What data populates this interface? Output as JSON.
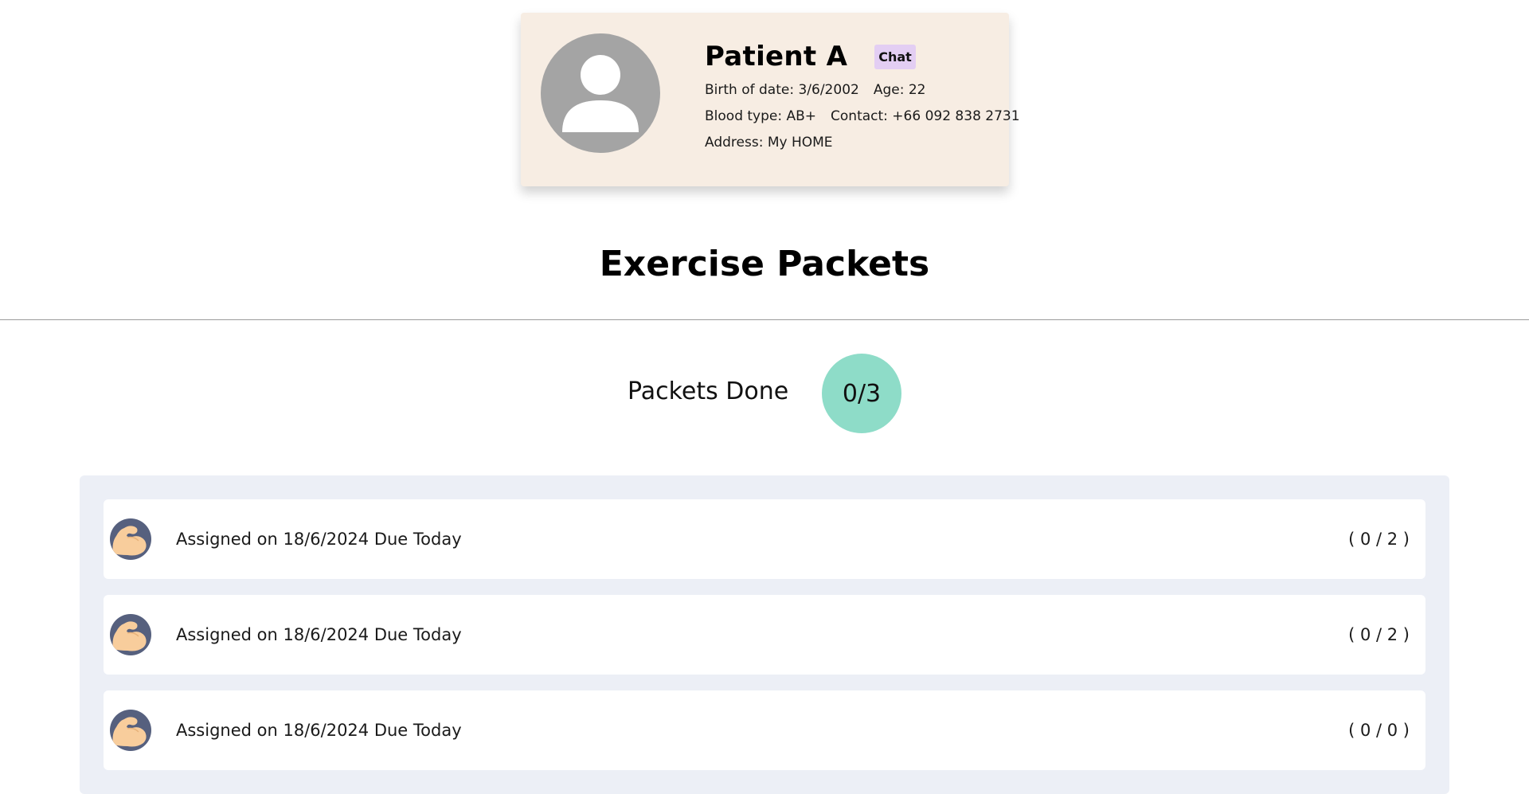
{
  "patient": {
    "name": "Patient A",
    "chat_label": "Chat",
    "birth_date": "Birth of date: 3/6/2002",
    "age": "Age: 22",
    "blood_type": "Blood type: AB+",
    "contact": "Contact: +66 092 838 2731",
    "address": "Address: My HOME",
    "avatar_icon": "user-silhouette-icon"
  },
  "section_title": "Exercise Packets",
  "packets_done": {
    "label": "Packets Done",
    "count": "0/3"
  },
  "packets": [
    {
      "icon": "flexed-biceps-icon",
      "text": "Assigned on 18/6/2024 Due Today",
      "progress": "( 0 / 2 )"
    },
    {
      "icon": "flexed-biceps-icon",
      "text": "Assigned on 18/6/2024 Due Today",
      "progress": "( 0 / 2 )"
    },
    {
      "icon": "flexed-biceps-icon",
      "text": "Assigned on 18/6/2024 Due Today",
      "progress": "( 0 / 0 )"
    }
  ],
  "colors": {
    "card_bg": "#f7ede3",
    "chat_bg": "#e3cef3",
    "count_bg": "#8edcc8",
    "list_bg": "#eceff6",
    "icon_bg": "#56607e"
  }
}
